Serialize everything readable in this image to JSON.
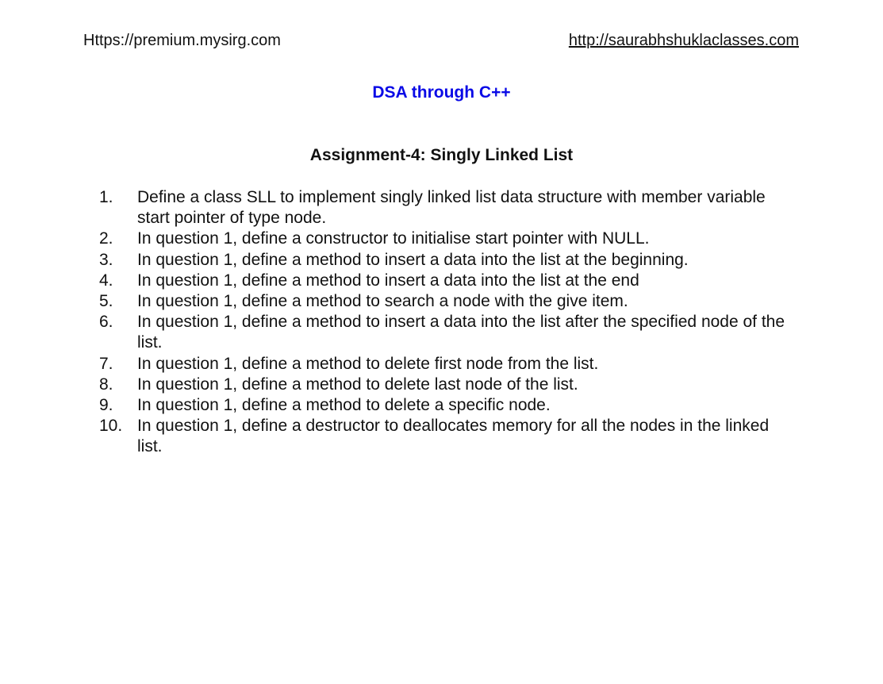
{
  "header": {
    "left_text": "Https://premium.mysirg.com",
    "right_link": "http://saurabhshuklaclasses.com"
  },
  "course_title": "DSA through C++",
  "assignment_title": "Assignment-4: Singly Linked List",
  "questions": [
    {
      "num": "1.",
      "text": "Define a class SLL to implement singly linked list data structure with member variable start pointer of type node."
    },
    {
      "num": "2.",
      "text": "In question 1, define a constructor to initialise start pointer with NULL."
    },
    {
      "num": "3.",
      "text": "In question 1, define a method to insert a data into the list at the beginning."
    },
    {
      "num": "4.",
      "text": "In question 1, define a method to insert a data into the list at the end"
    },
    {
      "num": "5.",
      "text": "In question 1, define a method to search a node with the give item."
    },
    {
      "num": "6.",
      "text": "In question 1, define a method to insert a data into the list after the specified node of the list."
    },
    {
      "num": "7.",
      "text": "In question 1, define a method to delete first node from the list."
    },
    {
      "num": "8.",
      "text": "In question 1, define a method to delete last node of the list."
    },
    {
      "num": "9.",
      "text": "In question 1, define a method to delete a specific node."
    },
    {
      "num": "10.",
      "text": "In question 1, define a destructor to deallocates memory for all the nodes in the linked list."
    }
  ],
  "colors": {
    "course_title": "#0a0ae6",
    "text": "#111111",
    "background": "#ffffff"
  }
}
